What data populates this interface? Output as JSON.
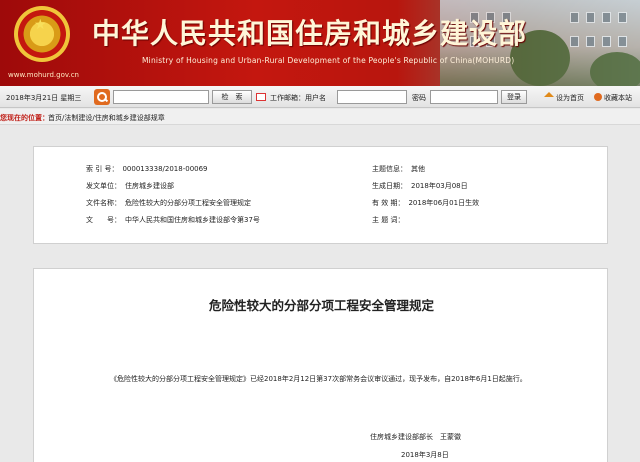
{
  "header": {
    "title": "中华人民共和国住房和城乡建设部",
    "subtitle": "Ministry of Housing and Urban-Rural Development of the People's Republic of China(MOHURD)",
    "url": "www.mohurd.gov.cn"
  },
  "toolbar": {
    "date": "2018年3月21日 星期三",
    "search_button": "检　索",
    "mail_label": "工作邮箱：用户名",
    "password_label": "密码",
    "login_button": "登录",
    "homepage_link": "设为首页",
    "favorite_link": "收藏本站"
  },
  "breadcrumb": {
    "label": "您现在的位置：",
    "items": [
      "首页",
      "法制建设",
      "住房和城乡建设部规章"
    ],
    "separator": "/"
  },
  "info": {
    "index_label": "索 引 号：",
    "index_value": "000013338/2018-00069",
    "issuer_label": "发文单位：",
    "issuer_value": "住房城乡建设部",
    "filename_label": "文件名称：",
    "filename_value": "危险性较大的分部分项工程安全管理规定",
    "docno_label": "文　　号：",
    "docno_value": "中华人民共和国住房和城乡建设部令第37号",
    "topic_label": "主题信息：",
    "topic_value": "其他",
    "gendate_label": "生成日期：",
    "gendate_value": "2018年03月08日",
    "valid_label": "有 效 期：",
    "valid_value": "2018年06月01日生效",
    "keywords_label": "主 题 词：",
    "keywords_value": ""
  },
  "article": {
    "title": "危险性较大的分部分项工程安全管理规定",
    "paragraph": "《危险性较大的分部分项工程安全管理规定》已经2018年2月12日第37次部常务会议审议通过，现予发布，自2018年6月1日起施行。",
    "signature": "住房城乡建设部部长　王蒙徽",
    "date": "2018年3月8日"
  },
  "colors": {
    "banner_red": "#c4170f",
    "location_label": "#c0211a",
    "accent_orange": "#e06a1f"
  }
}
